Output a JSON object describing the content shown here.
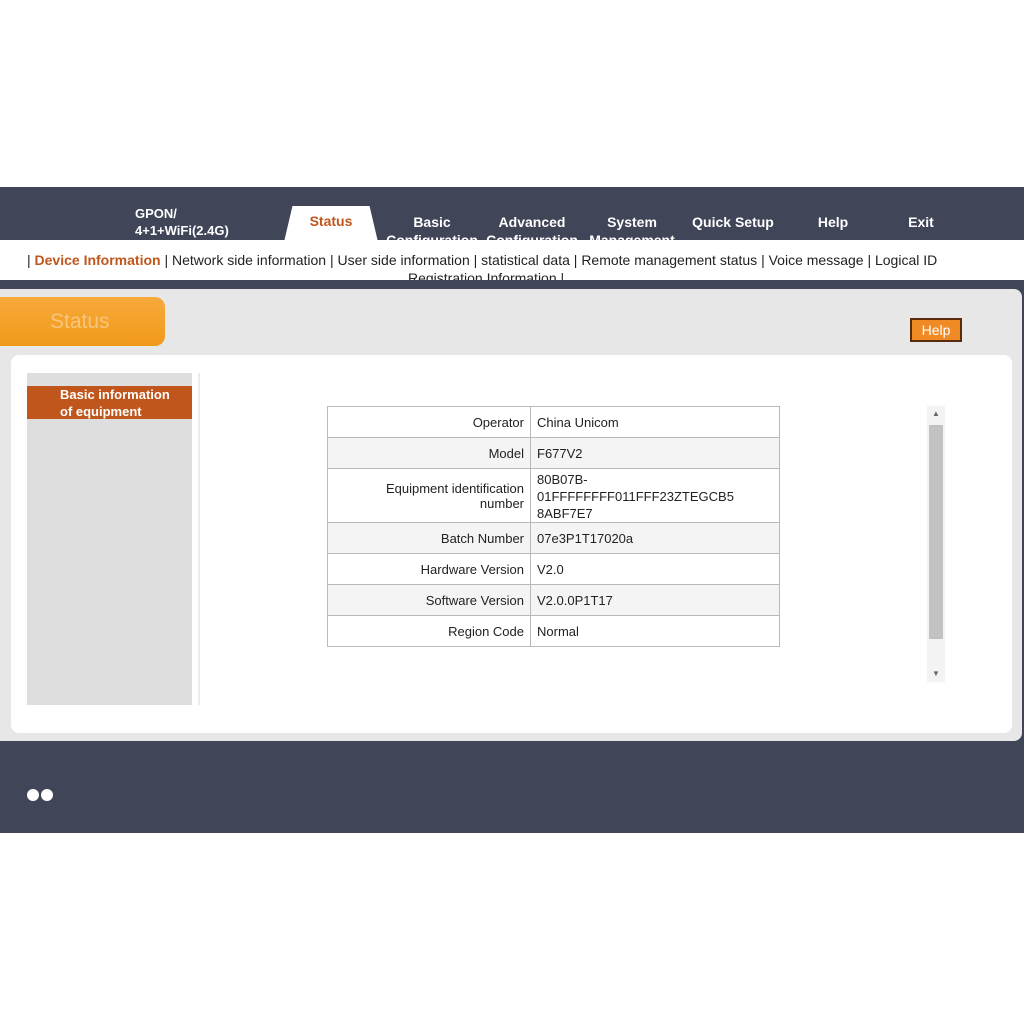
{
  "brand": {
    "line1": "GPON/",
    "line2": "4+1+WiFi(2.4G)"
  },
  "nav": {
    "status": "Status",
    "basic_line1": "Basic",
    "basic_line2": "Configuration",
    "advanced_line1": "Advanced",
    "advanced_line2": "Configuration",
    "system_line1": "System",
    "system_line2": "Management",
    "quick_setup": "Quick Setup",
    "help": "Help",
    "exit": "Exit"
  },
  "subnav": {
    "device_information": "Device Information",
    "network_side": "Network side information",
    "user_side": "User side information",
    "statistical_data": "statistical data",
    "remote_management": "Remote management status",
    "voice_message": "Voice message",
    "logical_id": "Logical ID",
    "registration": "Registration Information"
  },
  "panel": {
    "status_tab": "Status",
    "help_button": "Help"
  },
  "sidebar": {
    "item_line1": "Basic information",
    "item_line2": "of equipment"
  },
  "info": {
    "operator": {
      "label": "Operator",
      "value": "China Unicom"
    },
    "model": {
      "label": "Model",
      "value": "F677V2"
    },
    "equipment_id": {
      "label_line1": "Equipment identification",
      "label_line2": "number",
      "value_line1": "80B07B-",
      "value_line2": "01FFFFFFFF011FFF23ZTEGCB5",
      "value_line3": "8ABF7E7"
    },
    "batch": {
      "label": "Batch Number",
      "value": "07e3P1T17020a"
    },
    "hardware": {
      "label": "Hardware Version",
      "value": "V2.0"
    },
    "software": {
      "label": "Software Version",
      "value": "V2.0.0P1T17"
    },
    "region": {
      "label": "Region Code",
      "value": "Normal"
    }
  },
  "colors": {
    "accent": "#c0561b",
    "orange": "#f09a1a",
    "dark_bg": "#404557"
  }
}
